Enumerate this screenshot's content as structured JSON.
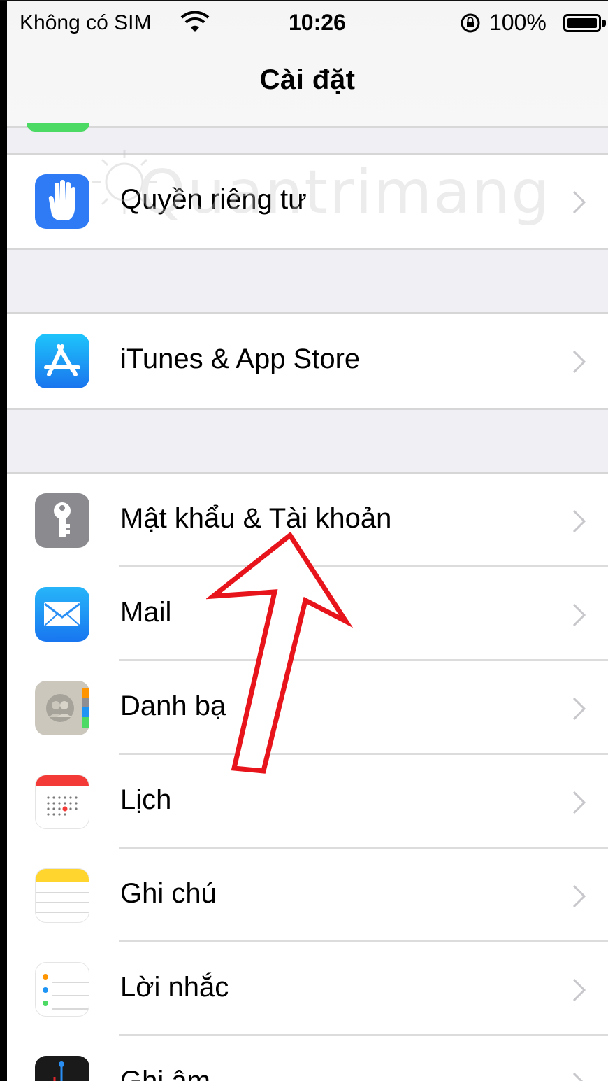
{
  "status_bar": {
    "carrier": "Không có SIM",
    "time": "10:26",
    "battery_percent": "100%"
  },
  "nav": {
    "title": "Cài đặt"
  },
  "watermark": {
    "text": "Quantrimang"
  },
  "groups": [
    {
      "rows": [
        {
          "label": "Quyền riêng tư",
          "icon": "hand-icon",
          "color": "#2f7bf5"
        }
      ]
    },
    {
      "rows": [
        {
          "label": "iTunes & App Store",
          "icon": "app-store-icon",
          "color": "#1e8ef3"
        }
      ]
    },
    {
      "rows": [
        {
          "label": "Mật khẩu & Tài khoản",
          "icon": "key-icon",
          "color": "#8e8e93"
        },
        {
          "label": "Mail",
          "icon": "envelope-icon",
          "color": "#1e95f5"
        },
        {
          "label": "Danh bạ",
          "icon": "contacts-icon",
          "color": "#c6c2b8"
        },
        {
          "label": "Lịch",
          "icon": "calendar-icon",
          "color": "#ffffff"
        },
        {
          "label": "Ghi chú",
          "icon": "notes-icon",
          "color": "#ffffff"
        },
        {
          "label": "Lời nhắc",
          "icon": "reminders-icon",
          "color": "#ffffff"
        },
        {
          "label": "Ghi âm",
          "icon": "voice-memo-icon",
          "color": "#1a1a1a"
        }
      ]
    }
  ],
  "annotation": {
    "arrow_color": "#e8141b"
  }
}
